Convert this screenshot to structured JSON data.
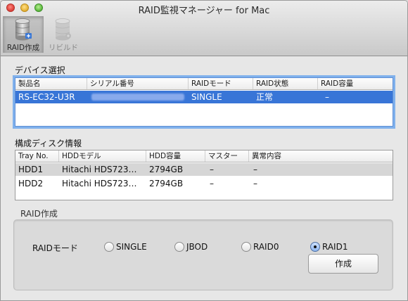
{
  "window": {
    "title": "RAID監視マネージャー for Mac"
  },
  "toolbar": {
    "create_label": "RAID作成",
    "rebuild_label": "リビルド"
  },
  "device_section": {
    "title": "デバイス選択",
    "columns": [
      "製品名",
      "シリアル番号",
      "RAIDモード",
      "RAID状態",
      "RAID容量"
    ],
    "rows": [
      {
        "product": "RS-EC32-U3R",
        "serial": "",
        "mode": "SINGLE",
        "status": "正常",
        "capacity": "–"
      }
    ]
  },
  "disk_section": {
    "title": "構成ディスク情報",
    "columns": [
      "Tray No.",
      "HDDモデル",
      "HDD容量",
      "マスター",
      "異常内容"
    ],
    "rows": [
      {
        "tray": "HDD1",
        "model": "Hitachi HDS723…",
        "capacity": "2794GB",
        "master": "–",
        "error": "–"
      },
      {
        "tray": "HDD2",
        "model": "Hitachi HDS723…",
        "capacity": "2794GB",
        "master": "–",
        "error": "–"
      }
    ]
  },
  "raid_create": {
    "title": "RAID作成",
    "mode_label": "RAIDモード",
    "options": [
      "SINGLE",
      "JBOD",
      "RAID0",
      "RAID1"
    ],
    "selected": "RAID1",
    "create_button": "作成"
  },
  "colors": {
    "selection": "#3875d7",
    "focus_ring": "#80b1ec"
  }
}
